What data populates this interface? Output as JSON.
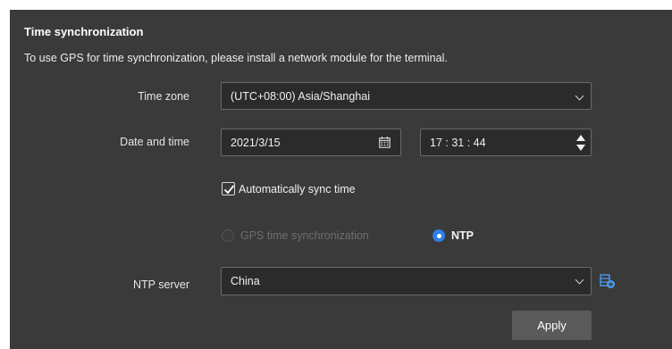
{
  "section": {
    "title": "Time synchronization",
    "description": "To use GPS for time synchronization, please install a network module for the terminal."
  },
  "time_zone": {
    "label": "Time zone",
    "value": "(UTC+08:00) Asia/Shanghai",
    "icon": "chevron-down-icon"
  },
  "date_time": {
    "label": "Date and time",
    "date_value": "2021/3/15",
    "date_icon": "calendar-icon",
    "time_value": "17 : 31 : 44",
    "time_icon": "spinner-arrows-icon"
  },
  "auto_sync": {
    "label": "Automatically sync time",
    "checked": true
  },
  "sync_mode": {
    "gps_label": "GPS time synchronization",
    "gps_enabled": false,
    "ntp_label": "NTP",
    "selected": "NTP"
  },
  "ntp_server": {
    "label": "NTP server",
    "value": "China",
    "add_icon": "add-server-icon"
  },
  "actions": {
    "apply_label": "Apply"
  },
  "colors": {
    "panel_bg": "#3a3a3a",
    "field_bg": "#2b2b2b",
    "accent": "#2f7fe6",
    "button_bg": "#5a5a5a"
  }
}
